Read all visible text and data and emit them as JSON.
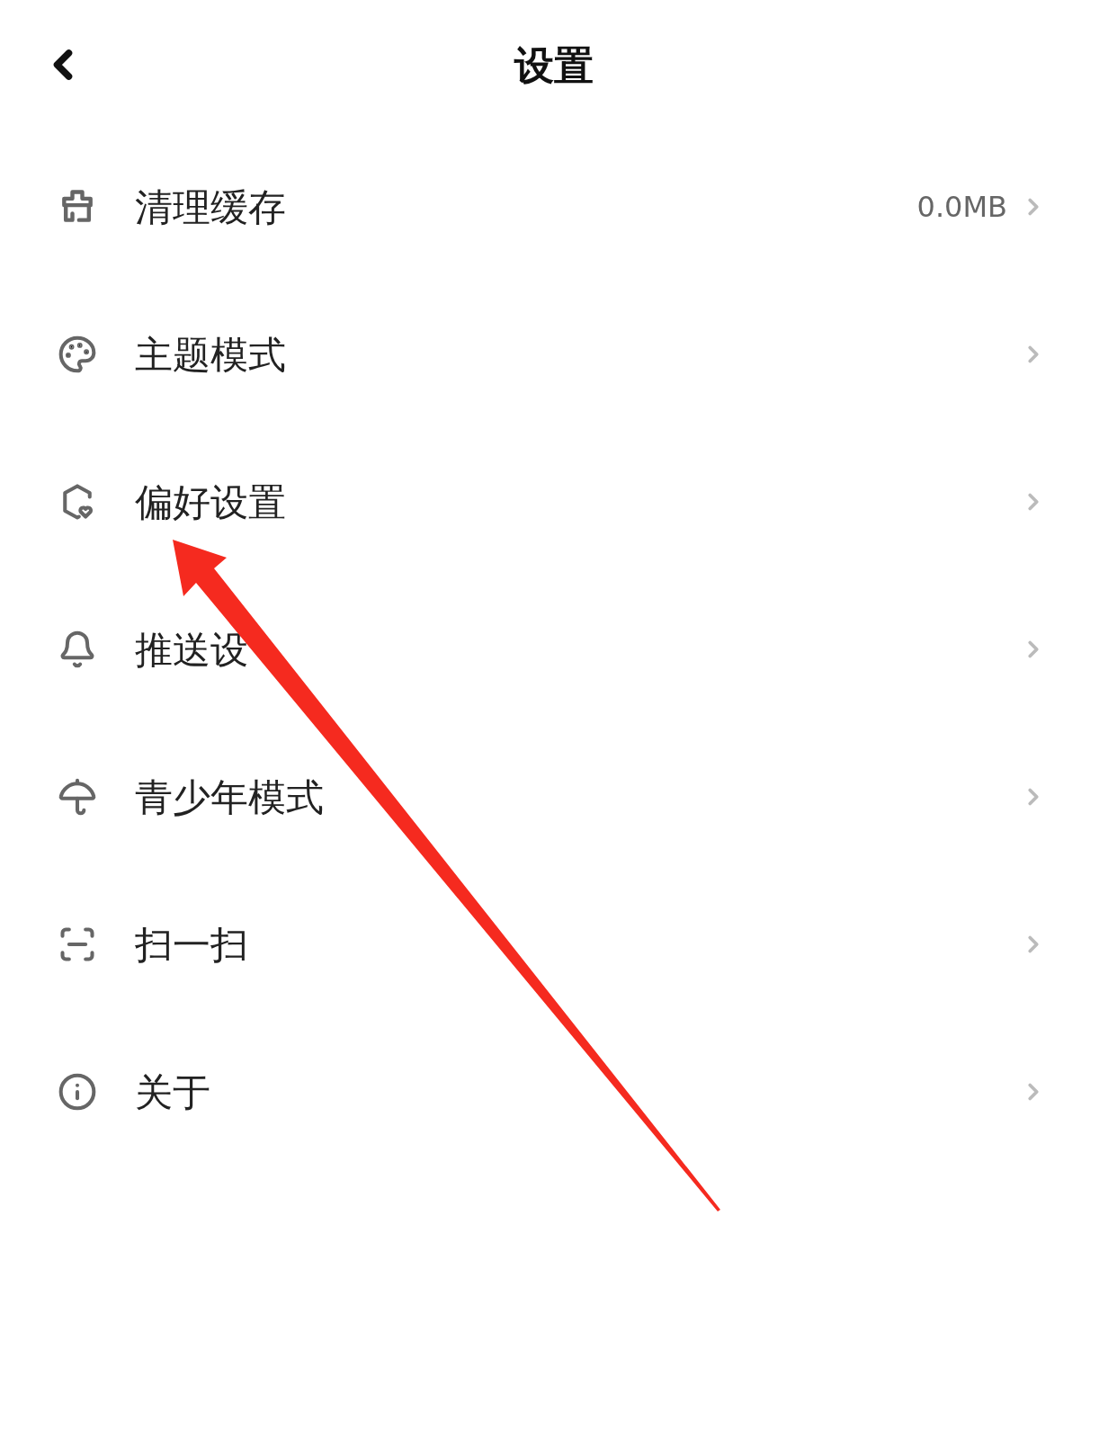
{
  "header": {
    "title": "设置"
  },
  "items": [
    {
      "kind": "cache",
      "label": "清理缓存",
      "value": "0.0MB"
    },
    {
      "kind": "theme",
      "label": "主题模式"
    },
    {
      "kind": "preference",
      "label": "偏好设置"
    },
    {
      "kind": "push",
      "label": "推送设"
    },
    {
      "kind": "youth",
      "label": "青少年模式"
    },
    {
      "kind": "scan",
      "label": "扫一扫"
    },
    {
      "kind": "about",
      "label": "关于"
    }
  ],
  "annotation": {
    "kind": "arrow"
  }
}
